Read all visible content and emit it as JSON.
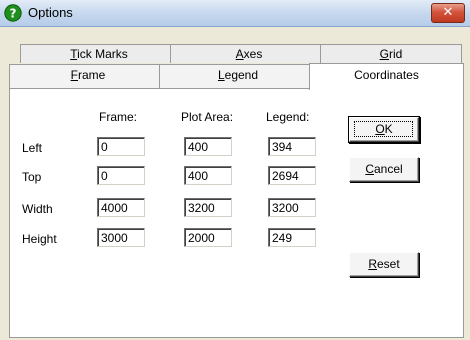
{
  "window": {
    "title": "Options",
    "close_glyph": "✕"
  },
  "tabs": {
    "back_row": [
      {
        "label_pre": "",
        "label_ul": "T",
        "label_post": "ick Marks"
      },
      {
        "label_pre": "",
        "label_ul": "A",
        "label_post": "xes"
      },
      {
        "label_pre": "",
        "label_ul": "G",
        "label_post": "rid"
      }
    ],
    "front_row": [
      {
        "label_pre": "",
        "label_ul": "F",
        "label_post": "rame"
      },
      {
        "label_pre": "",
        "label_ul": "L",
        "label_post": "egend"
      },
      {
        "label_pre": "Coordinates",
        "label_ul": "",
        "label_post": ""
      }
    ],
    "active": "Coordinates"
  },
  "columns": {
    "frame": "Frame:",
    "plot_area": "Plot Area:",
    "legend": "Legend:"
  },
  "rows": [
    {
      "label": "Left",
      "frame": "0",
      "plot_area": "400",
      "legend": "394"
    },
    {
      "label": "Top",
      "frame": "0",
      "plot_area": "400",
      "legend": "2694"
    },
    {
      "label": "Width",
      "frame": "4000",
      "plot_area": "3200",
      "legend": "3200"
    },
    {
      "label": "Height",
      "frame": "3000",
      "plot_area": "2000",
      "legend": "249"
    }
  ],
  "buttons": {
    "ok": {
      "ul": "O",
      "rest": "K"
    },
    "cancel": {
      "ul": "C",
      "rest": "ancel"
    },
    "reset": {
      "ul": "R",
      "rest": "eset"
    }
  },
  "icons": {
    "app": "help-question-icon",
    "close": "close-icon"
  },
  "colors": {
    "app_icon_green": "#1e8f1e",
    "close_red": "#c0391f"
  }
}
